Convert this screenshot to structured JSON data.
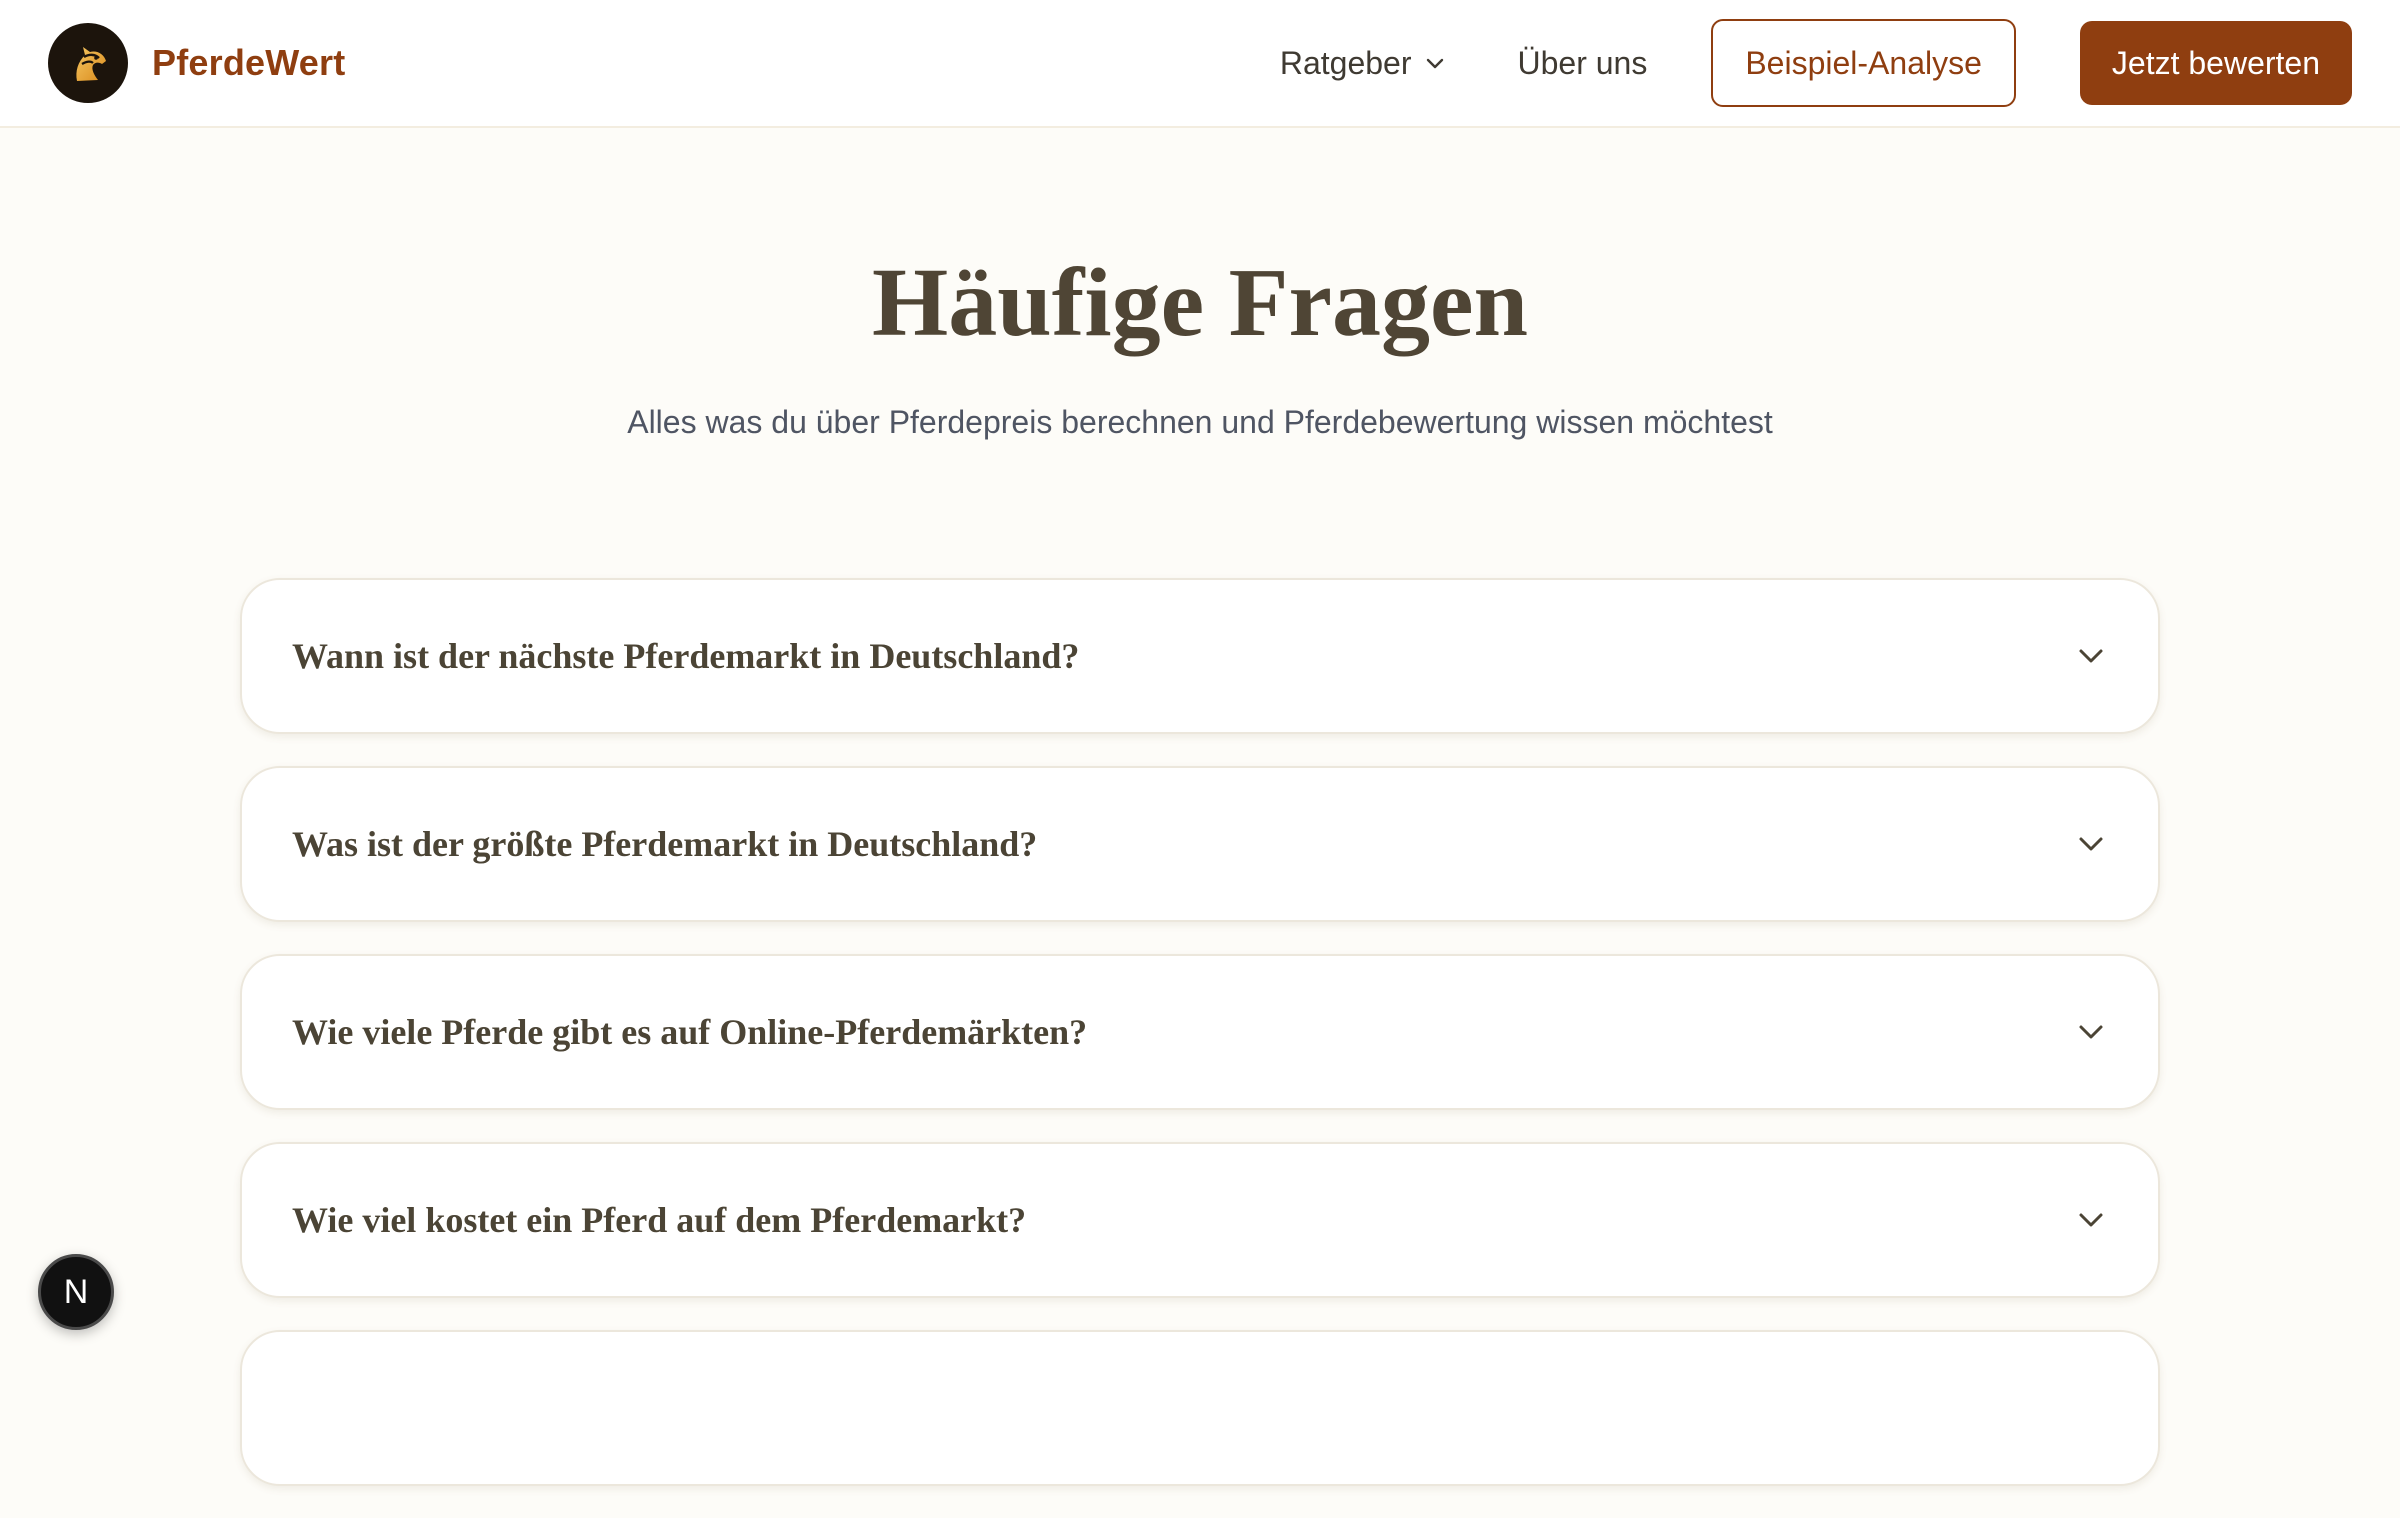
{
  "header": {
    "brand_name": "PferdeWert",
    "nav": {
      "ratgeber_label": "Ratgeber",
      "about_label": "Über uns",
      "example_label": "Beispiel-Analyse",
      "cta_label": "Jetzt bewerten"
    }
  },
  "hero": {
    "title": "Häufige Fragen",
    "subtitle": "Alles was du über Pferdepreis berechnen und Pferdebewertung wissen möchtest"
  },
  "faq": {
    "items": [
      {
        "question": "Wann ist der nächste Pferdemarkt in Deutschland?"
      },
      {
        "question": "Was ist der größte Pferdemarkt in Deutschland?"
      },
      {
        "question": "Wie viele Pferde gibt es auf Online-Pferdemärkten?"
      },
      {
        "question": "Wie viel kostet ein Pferd auf dem Pferdemarkt?"
      },
      {
        "question": ""
      }
    ]
  },
  "floating_badge": {
    "letter": "N"
  },
  "icons": {
    "logo": "horse-head-logo-icon",
    "nav_dropdown": "chevron-down-icon",
    "faq_toggle": "chevron-down-icon"
  },
  "colors": {
    "brand": "#8f3e10",
    "background": "#fdfcf8",
    "heading": "#4f4535",
    "logo_bg": "#1c140c",
    "logo_fg": "#e9a93c"
  }
}
